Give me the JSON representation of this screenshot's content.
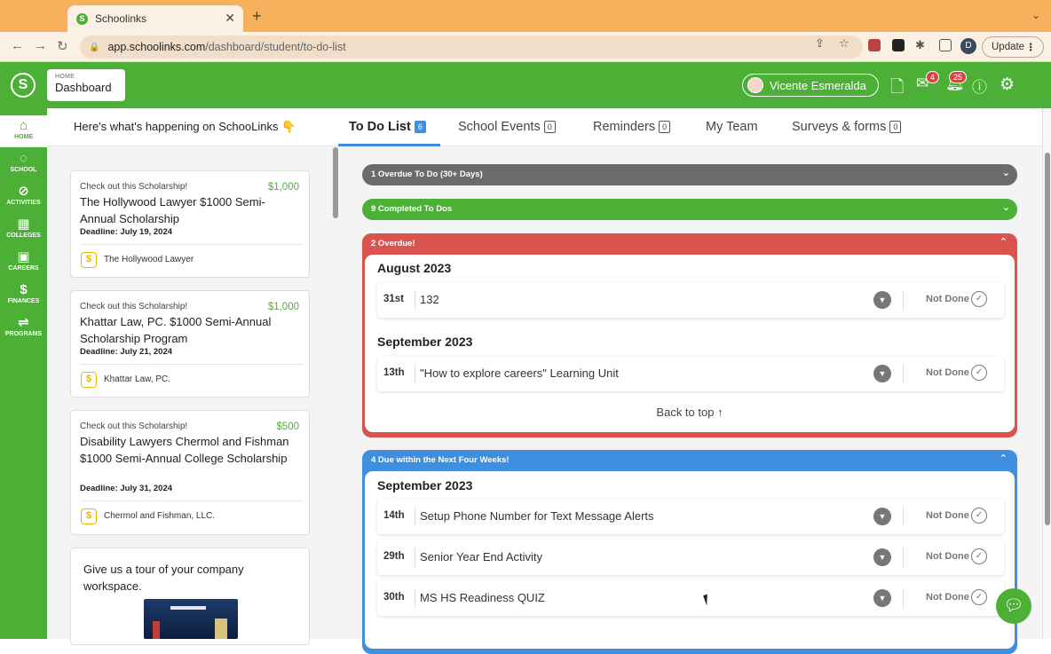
{
  "browser": {
    "tab_title": "Schoolinks",
    "tab_favicon_icon": "schoolinks-logo-icon",
    "new_tab_icon": "plus-icon",
    "url_host": "app.schoolinks.com",
    "url_path": "/dashboard/student/to-do-list",
    "profile_initial": "D",
    "update_label": "Update"
  },
  "header": {
    "breadcrumb_small": "HOME",
    "breadcrumb_title": "Dashboard",
    "user_name": "Vicente Esmeralda",
    "messages_badge": "4",
    "notifications_badge": "25"
  },
  "sidebar": {
    "items": [
      {
        "label": "HOME",
        "icon": "home-icon",
        "active": true
      },
      {
        "label": "SCHOOL",
        "icon": "apple-icon"
      },
      {
        "label": "ACTIVITIES",
        "icon": "compass-icon"
      },
      {
        "label": "COLLEGES",
        "icon": "building-icon"
      },
      {
        "label": "CAREERS",
        "icon": "briefcase-icon"
      },
      {
        "label": "FINANCES",
        "icon": "money-bag-icon"
      },
      {
        "label": "PROGRAMS",
        "icon": "programs-icon"
      }
    ]
  },
  "left_panel": {
    "heading": "Here's what's happening on SchooLinks 👇",
    "cards": [
      {
        "kicker": "Check out this Scholarship!",
        "amount": "$1,000",
        "title": "The Hollywood Lawyer $1000 Semi-Annual Scholarship",
        "deadline": "Deadline: July 19, 2024",
        "sponsor": "The Hollywood Lawyer"
      },
      {
        "kicker": "Check out this Scholarship!",
        "amount": "$1,000",
        "title": "Khattar Law, PC. $1000 Semi-Annual Scholarship Program",
        "deadline": "Deadline: July 21, 2024",
        "sponsor": "Khattar Law, PC."
      },
      {
        "kicker": "Check out this Scholarship!",
        "amount": "$500",
        "title": "Disability Lawyers Chermol and Fishman $1000 Semi-Annual College Scholarship",
        "deadline": "Deadline: July 31, 2024",
        "sponsor": "Chermol and Fishman, LLC."
      }
    ],
    "tour_card": {
      "text": "Give us a tour of your company workspace."
    }
  },
  "tabs": [
    {
      "label": "To Do List",
      "count": "6",
      "active": true
    },
    {
      "label": "School Events",
      "count": "0"
    },
    {
      "label": "Reminders",
      "count": "0"
    },
    {
      "label": "My Team",
      "count": ""
    },
    {
      "label": "Surveys & forms",
      "count": "0"
    }
  ],
  "todo": {
    "overdue_old_label": "1 Overdue To Do (30+ Days)",
    "completed_label": "9 Completed To Dos",
    "overdue_group": {
      "label": "2 Overdue!",
      "months": [
        {
          "name": "August 2023",
          "items": [
            {
              "day": "31st",
              "title": "132",
              "status": "Not Done"
            }
          ]
        },
        {
          "name": "September 2023",
          "items": [
            {
              "day": "13th",
              "title": "\"How to explore careers\" Learning Unit",
              "status": "Not Done"
            }
          ]
        }
      ],
      "back_to_top": "Back to top ↑"
    },
    "due_group": {
      "label": "4 Due within the Next Four Weeks!",
      "months": [
        {
          "name": "September 2023",
          "items": [
            {
              "day": "14th",
              "title": "Setup Phone Number for Text Message Alerts",
              "status": "Not Done"
            },
            {
              "day": "29th",
              "title": "Senior Year End Activity",
              "status": "Not Done"
            },
            {
              "day": "30th",
              "title": "MS HS Readiness QUIZ",
              "status": "Not Done"
            }
          ]
        }
      ]
    }
  },
  "colors": {
    "brand_green": "#4caf36",
    "overdue_red": "#d9534f",
    "due_blue": "#3f8fe0",
    "collapsed_gray": "#6b6b6b"
  }
}
